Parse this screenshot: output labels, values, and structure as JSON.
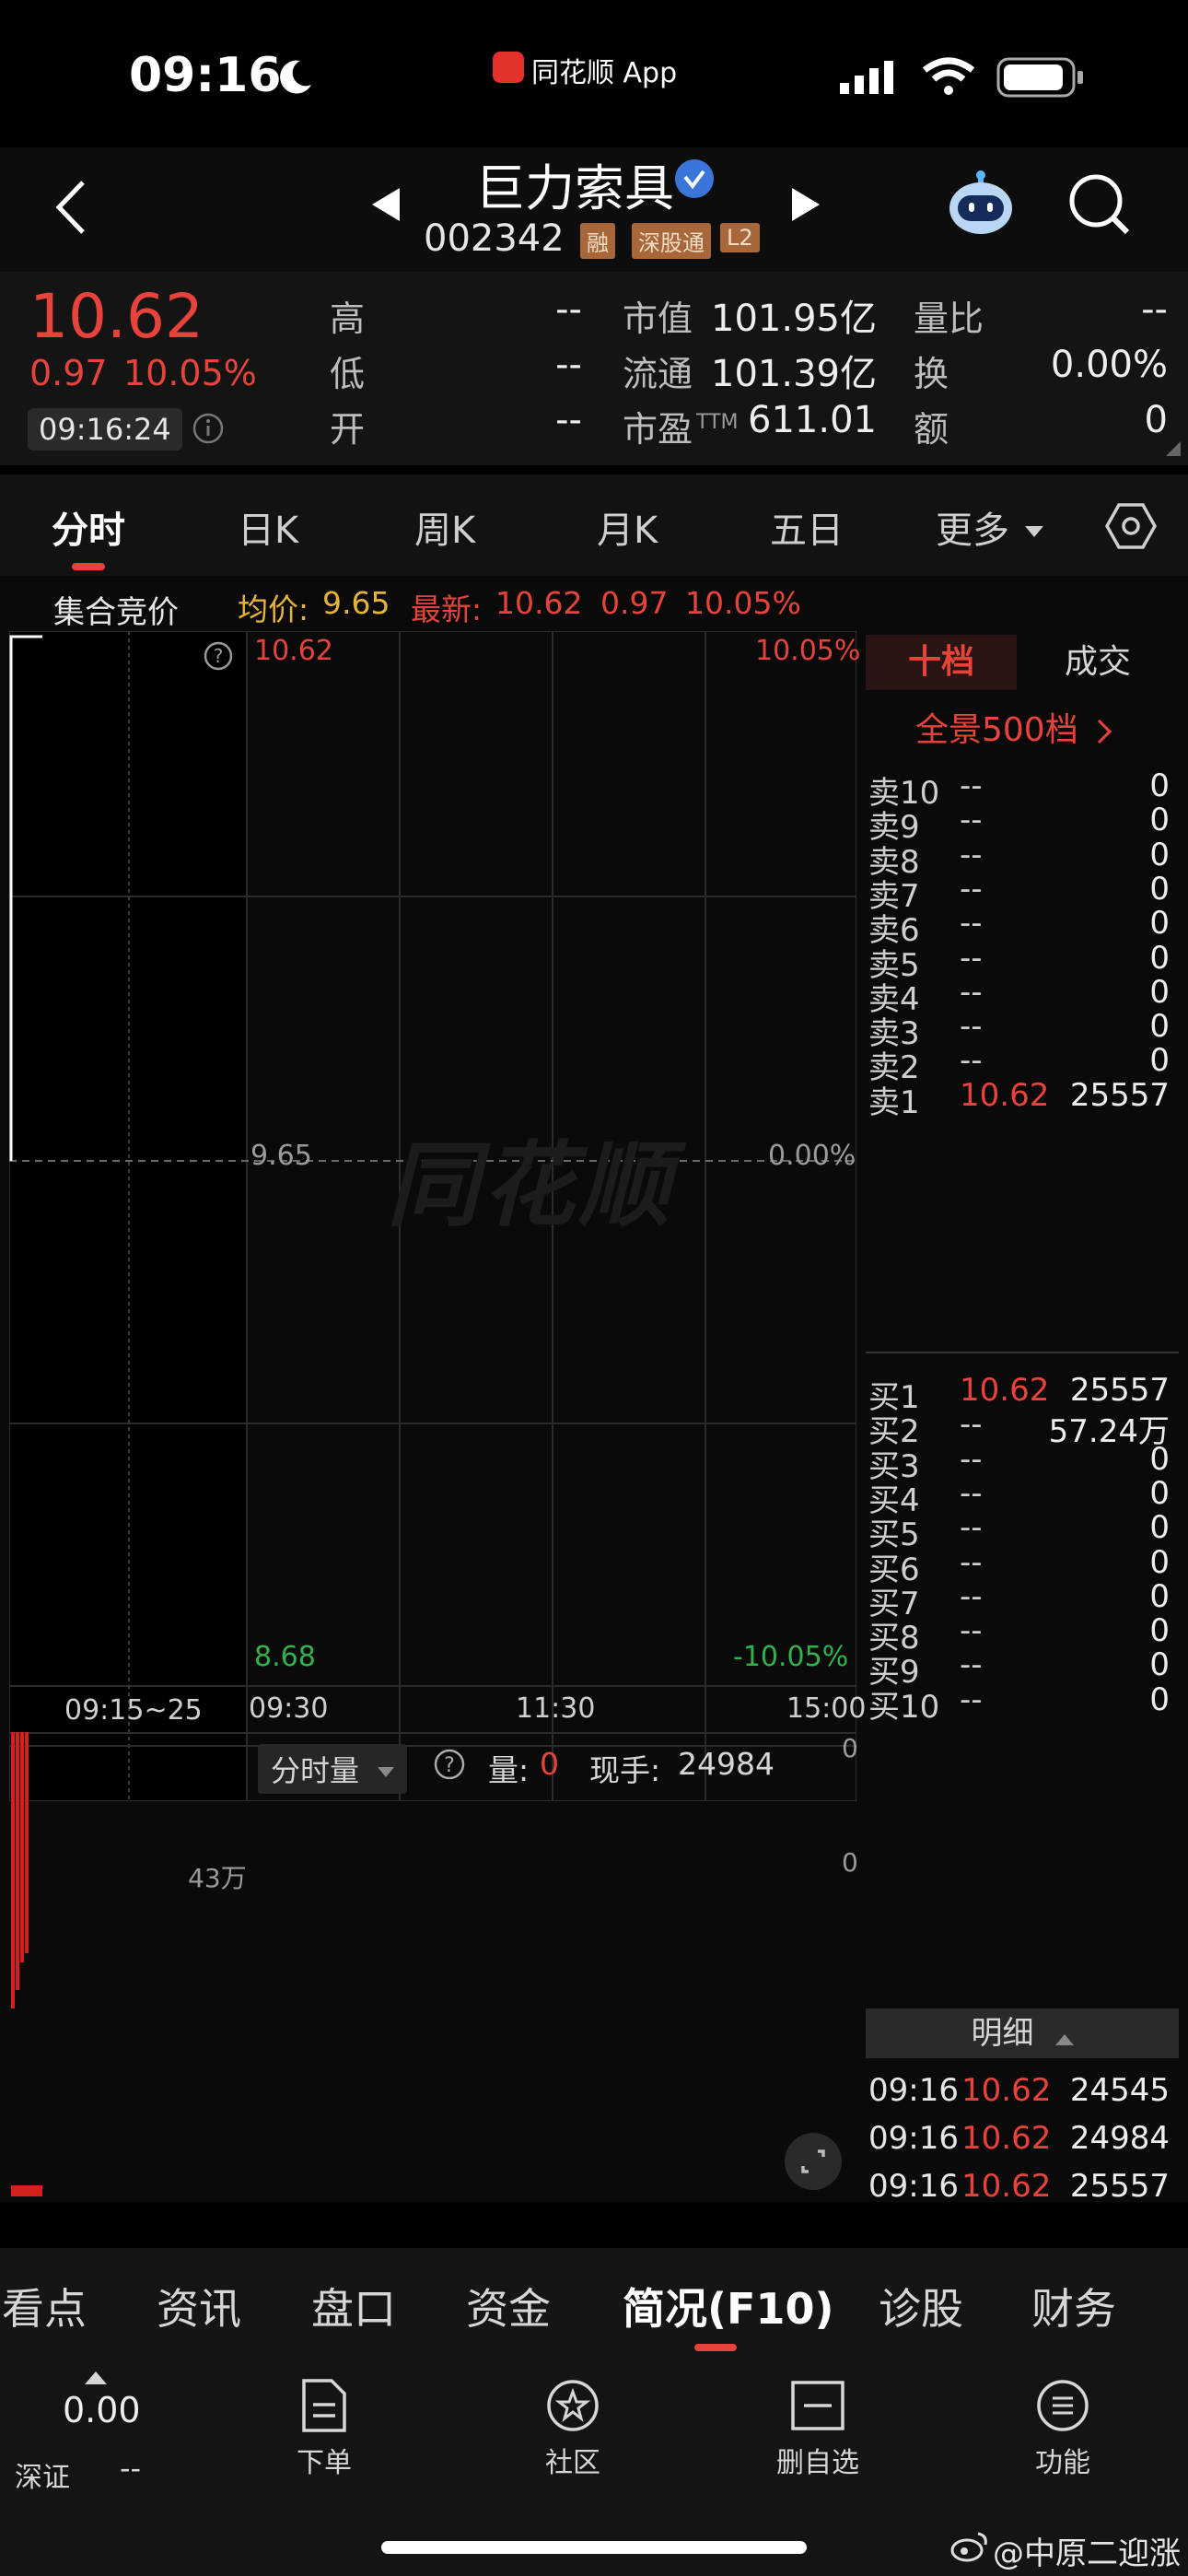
{
  "status_bar": {
    "time": "09:16",
    "app_label": "同花顺 App"
  },
  "nav": {
    "title": "巨力索具",
    "code": "002342",
    "badges": [
      "融",
      "深股通",
      "L2"
    ]
  },
  "quote": {
    "price": "10.62",
    "change": "0.97",
    "change_pct": "10.05%",
    "time": "09:16:24",
    "col1": [
      {
        "label": "高",
        "value": "--"
      },
      {
        "label": "低",
        "value": "--"
      },
      {
        "label": "开",
        "value": "--"
      }
    ],
    "col2": [
      {
        "label": "市值",
        "value": "101.95亿"
      },
      {
        "label": "流通",
        "value": "101.39亿"
      },
      {
        "label": "市盈",
        "sup": "TTM",
        "value": "611.01"
      }
    ],
    "col3": [
      {
        "label": "量比",
        "value": "--"
      },
      {
        "label": "换",
        "value": "0.00%"
      },
      {
        "label": "额",
        "value": "0"
      }
    ]
  },
  "chart_tabs": [
    "分时",
    "日K",
    "周K",
    "月K",
    "五日",
    "更多"
  ],
  "active_chart_tab": "分时",
  "auction_bar": {
    "label": "集合竞价",
    "avg_label": "均价:",
    "avg_value": "9.65",
    "latest_label": "最新:",
    "latest_value": "10.62",
    "change": "0.97",
    "change_pct": "10.05%"
  },
  "chart": {
    "watermark": "同花顺",
    "price_top": "10.62",
    "price_mid": "9.65",
    "price_bottom": "8.68",
    "pct_top": "10.05%",
    "pct_mid": "0.00%",
    "pct_bottom": "-10.05%",
    "time_auction": "09:15~25",
    "time_start": "09:30",
    "time_mid": "11:30",
    "time_end": "15:00",
    "vol_selector": "分时量",
    "vol_label": "量:",
    "vol_value": "0",
    "hand_label": "现手:",
    "hand_value": "24984",
    "vol_axis_top": "0",
    "vol_axis_mid": "0",
    "vol_axis_left": "43万"
  },
  "chart_data": {
    "type": "line",
    "title": "",
    "x": [
      "09:30",
      "11:30",
      "15:00"
    ],
    "ylim": [
      8.68,
      10.62
    ],
    "y_pct": [
      "10.05%",
      "0.00%",
      "-10.05%"
    ],
    "series": []
  },
  "order_book": {
    "tabs": [
      "十档",
      "成交"
    ],
    "panorama": "全景500档",
    "asks": [
      {
        "label": "卖10",
        "price": "--",
        "volume": "0"
      },
      {
        "label": "卖9",
        "price": "--",
        "volume": "0"
      },
      {
        "label": "卖8",
        "price": "--",
        "volume": "0"
      },
      {
        "label": "卖7",
        "price": "--",
        "volume": "0"
      },
      {
        "label": "卖6",
        "price": "--",
        "volume": "0"
      },
      {
        "label": "卖5",
        "price": "--",
        "volume": "0"
      },
      {
        "label": "卖4",
        "price": "--",
        "volume": "0"
      },
      {
        "label": "卖3",
        "price": "--",
        "volume": "0"
      },
      {
        "label": "卖2",
        "price": "--",
        "volume": "0"
      },
      {
        "label": "卖1",
        "price": "10.62",
        "volume": "25557"
      }
    ],
    "bids": [
      {
        "label": "买1",
        "price": "10.62",
        "volume": "25557"
      },
      {
        "label": "买2",
        "price": "--",
        "volume": "57.24万"
      },
      {
        "label": "买3",
        "price": "--",
        "volume": "0"
      },
      {
        "label": "买4",
        "price": "--",
        "volume": "0"
      },
      {
        "label": "买5",
        "price": "--",
        "volume": "0"
      },
      {
        "label": "买6",
        "price": "--",
        "volume": "0"
      },
      {
        "label": "买7",
        "price": "--",
        "volume": "0"
      },
      {
        "label": "买8",
        "price": "--",
        "volume": "0"
      },
      {
        "label": "买9",
        "price": "--",
        "volume": "0"
      },
      {
        "label": "买10",
        "price": "--",
        "volume": "0"
      }
    ],
    "detail_label": "明细",
    "details": [
      {
        "time": "09:16",
        "price": "10.62",
        "volume": "24545"
      },
      {
        "time": "09:16",
        "price": "10.62",
        "volume": "24984"
      },
      {
        "time": "09:16",
        "price": "10.62",
        "volume": "25557"
      }
    ]
  },
  "bottom_tabs": [
    "看点",
    "资讯",
    "盘口",
    "资金",
    "简况(F10)",
    "诊股",
    "财务"
  ],
  "active_bottom_tab": "简况(F10)",
  "toolbar": {
    "index_value": "0.00",
    "index_name": "深证",
    "index_change": "--",
    "items": [
      {
        "label": "下单",
        "icon": "document-icon"
      },
      {
        "label": "社区",
        "icon": "star-badge-icon"
      },
      {
        "label": "删自选",
        "icon": "minus-box-icon"
      },
      {
        "label": "功能",
        "icon": "menu-circle-icon"
      }
    ]
  },
  "watermark_credit": "@中原二迎涨"
}
